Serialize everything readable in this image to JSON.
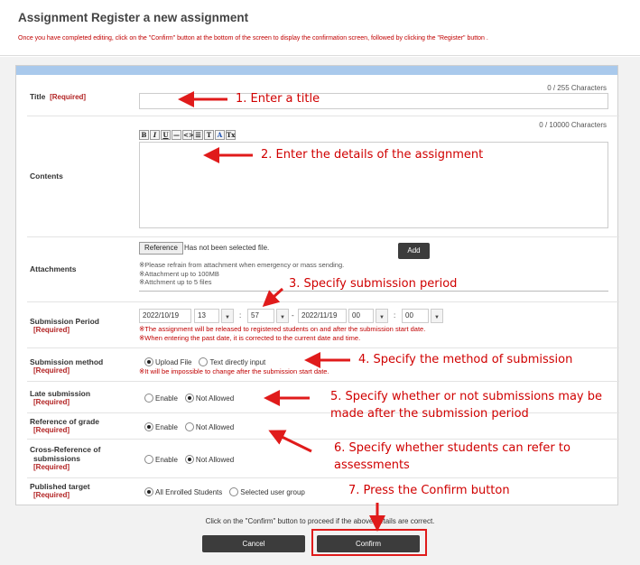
{
  "header": {
    "title": "Assignment Register a new assignment",
    "note": "Once you have completed editing, click on the \"Confirm\" button at the bottom of the screen to display the confirmation screen, followed by clicking the \"Register\" button ."
  },
  "form": {
    "required_tag": "[Required]",
    "title": {
      "label": "Title",
      "counter": "0 / 255 Characters",
      "value": ""
    },
    "contents": {
      "label": "Contents",
      "counter": "0 / 10000 Characters",
      "toolbar": [
        "B",
        "I",
        "U",
        "—",
        "<>",
        "☰",
        "T",
        "A",
        "Tx"
      ]
    },
    "attachments": {
      "label": "Attachments",
      "reference_button": "Reference",
      "status": "Has not been selected file.",
      "add_button": "Add",
      "notes": [
        "※Please refrain from attachment when emergency or mass sending.",
        "※Attachment up to 100MB",
        "※Attchment up to 5 files"
      ]
    },
    "submission_period": {
      "label": "Submission Period",
      "start_date": "2022/10/19",
      "start_hour": "13",
      "start_minute": "57",
      "separator": "-",
      "end_date": "2022/11/19",
      "end_hour": "00",
      "end_minute": "00",
      "notes": [
        "※The assignment will be released to registered students on and after the submission start date.",
        "※When entering the past date, it is corrected to the current date and time."
      ]
    },
    "submission_method": {
      "label": "Submission method",
      "options": [
        "Upload File",
        "Text directly input"
      ],
      "selected": "Upload File",
      "note": "※It will be impossible to change after the submission start date."
    },
    "late_submission": {
      "label": "Late submission",
      "options": [
        "Enable",
        "Not Allowed"
      ],
      "selected": "Not Allowed"
    },
    "reference_of_grade": {
      "label": "Reference of grade",
      "options": [
        "Enable",
        "Not Allowed"
      ],
      "selected": "Enable"
    },
    "cross_reference": {
      "label_line1": "Cross-Reference of",
      "label_line2": "submissions",
      "options": [
        "Enable",
        "Not Allowed"
      ],
      "selected": "Not Allowed"
    },
    "published_target": {
      "label": "Published target",
      "options": [
        "All Enrolled Students",
        "Selected user group"
      ],
      "selected": "All Enrolled Students"
    }
  },
  "footer": {
    "note": "Click on the \"Confirm\" button to proceed if the above details are correct.",
    "cancel": "Cancel",
    "confirm": "Confirm"
  },
  "annotations": {
    "a1": "1. Enter a title",
    "a2": "2. Enter the details of the assignment",
    "a3": "3. Specify submission period",
    "a4": "4. Specify the method  of submission",
    "a5_line1": "5. Specify whether or not submissions may be",
    "a5_line2": "made after the submission period",
    "a6_line1": "6. Specify whether students can refer to",
    "a6_line2": "assessments",
    "a7": "7. Press the Confirm button"
  },
  "colors": {
    "annotation": "#d00000",
    "panel_header": "#a9c9ec",
    "required": "#b22222",
    "button": "#3c3c3c"
  },
  "icons": [
    "arrow-icon"
  ]
}
